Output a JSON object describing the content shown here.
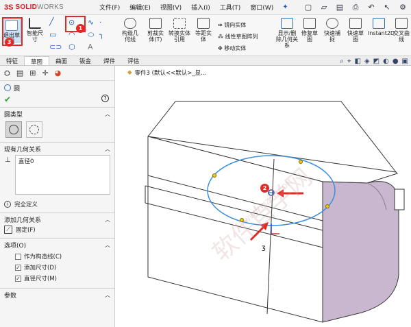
{
  "app": {
    "logo_mark": "3S",
    "logo_name": "SOLID",
    "logo_name_2": "WORKS"
  },
  "menu": [
    "文件(F)",
    "编辑(E)",
    "视图(V)",
    "插入(I)",
    "工具(T)",
    "窗口(W)"
  ],
  "ribbon": {
    "exit_sketch": "退出草图",
    "smart_dim": "智能尺寸",
    "trim": "剪裁实体(T)",
    "convert": "转换实体引用",
    "offset": "等距实体",
    "construct": "构造几何线",
    "mirror": "镜向实体",
    "linear_pattern": "线性草图阵列",
    "move": "移动实体",
    "show_delete": "显示/删除几何关系",
    "repair": "修复草图",
    "quick_snap": "快速捕捉",
    "rapid_sketch": "快速草图",
    "instant2d": "Instant2D",
    "shaded": "交叉曲线"
  },
  "tabs": [
    "特征",
    "草图",
    "曲面",
    "钣金",
    "焊件",
    "评估"
  ],
  "breadcrumb": "零件3 (默认<<默认>_显...",
  "panel": {
    "title": "圆",
    "circle_type": "圆类型",
    "existing_relations": "现有几何关系",
    "relation_item": "直径0",
    "fully_defined": "完全定义",
    "add_relations": "添加几何关系",
    "fix": "固定(F)",
    "options": "选项(O)",
    "opt_construction": "作为构造线(C)",
    "opt_add_dim": "添加尺寸(D)",
    "opt_diameter": "直径尺寸(M)",
    "params": "参数"
  },
  "badges": [
    "1",
    "2",
    "3"
  ],
  "watermark": "软件自学网",
  "watermark_url": "WWW.RJZXW.COM",
  "colors": {
    "accent_red": "#e02a25",
    "sketch_blue": "#3b8fe0",
    "solid_face": "#ffffff",
    "side_face": "#c8b7cf"
  }
}
